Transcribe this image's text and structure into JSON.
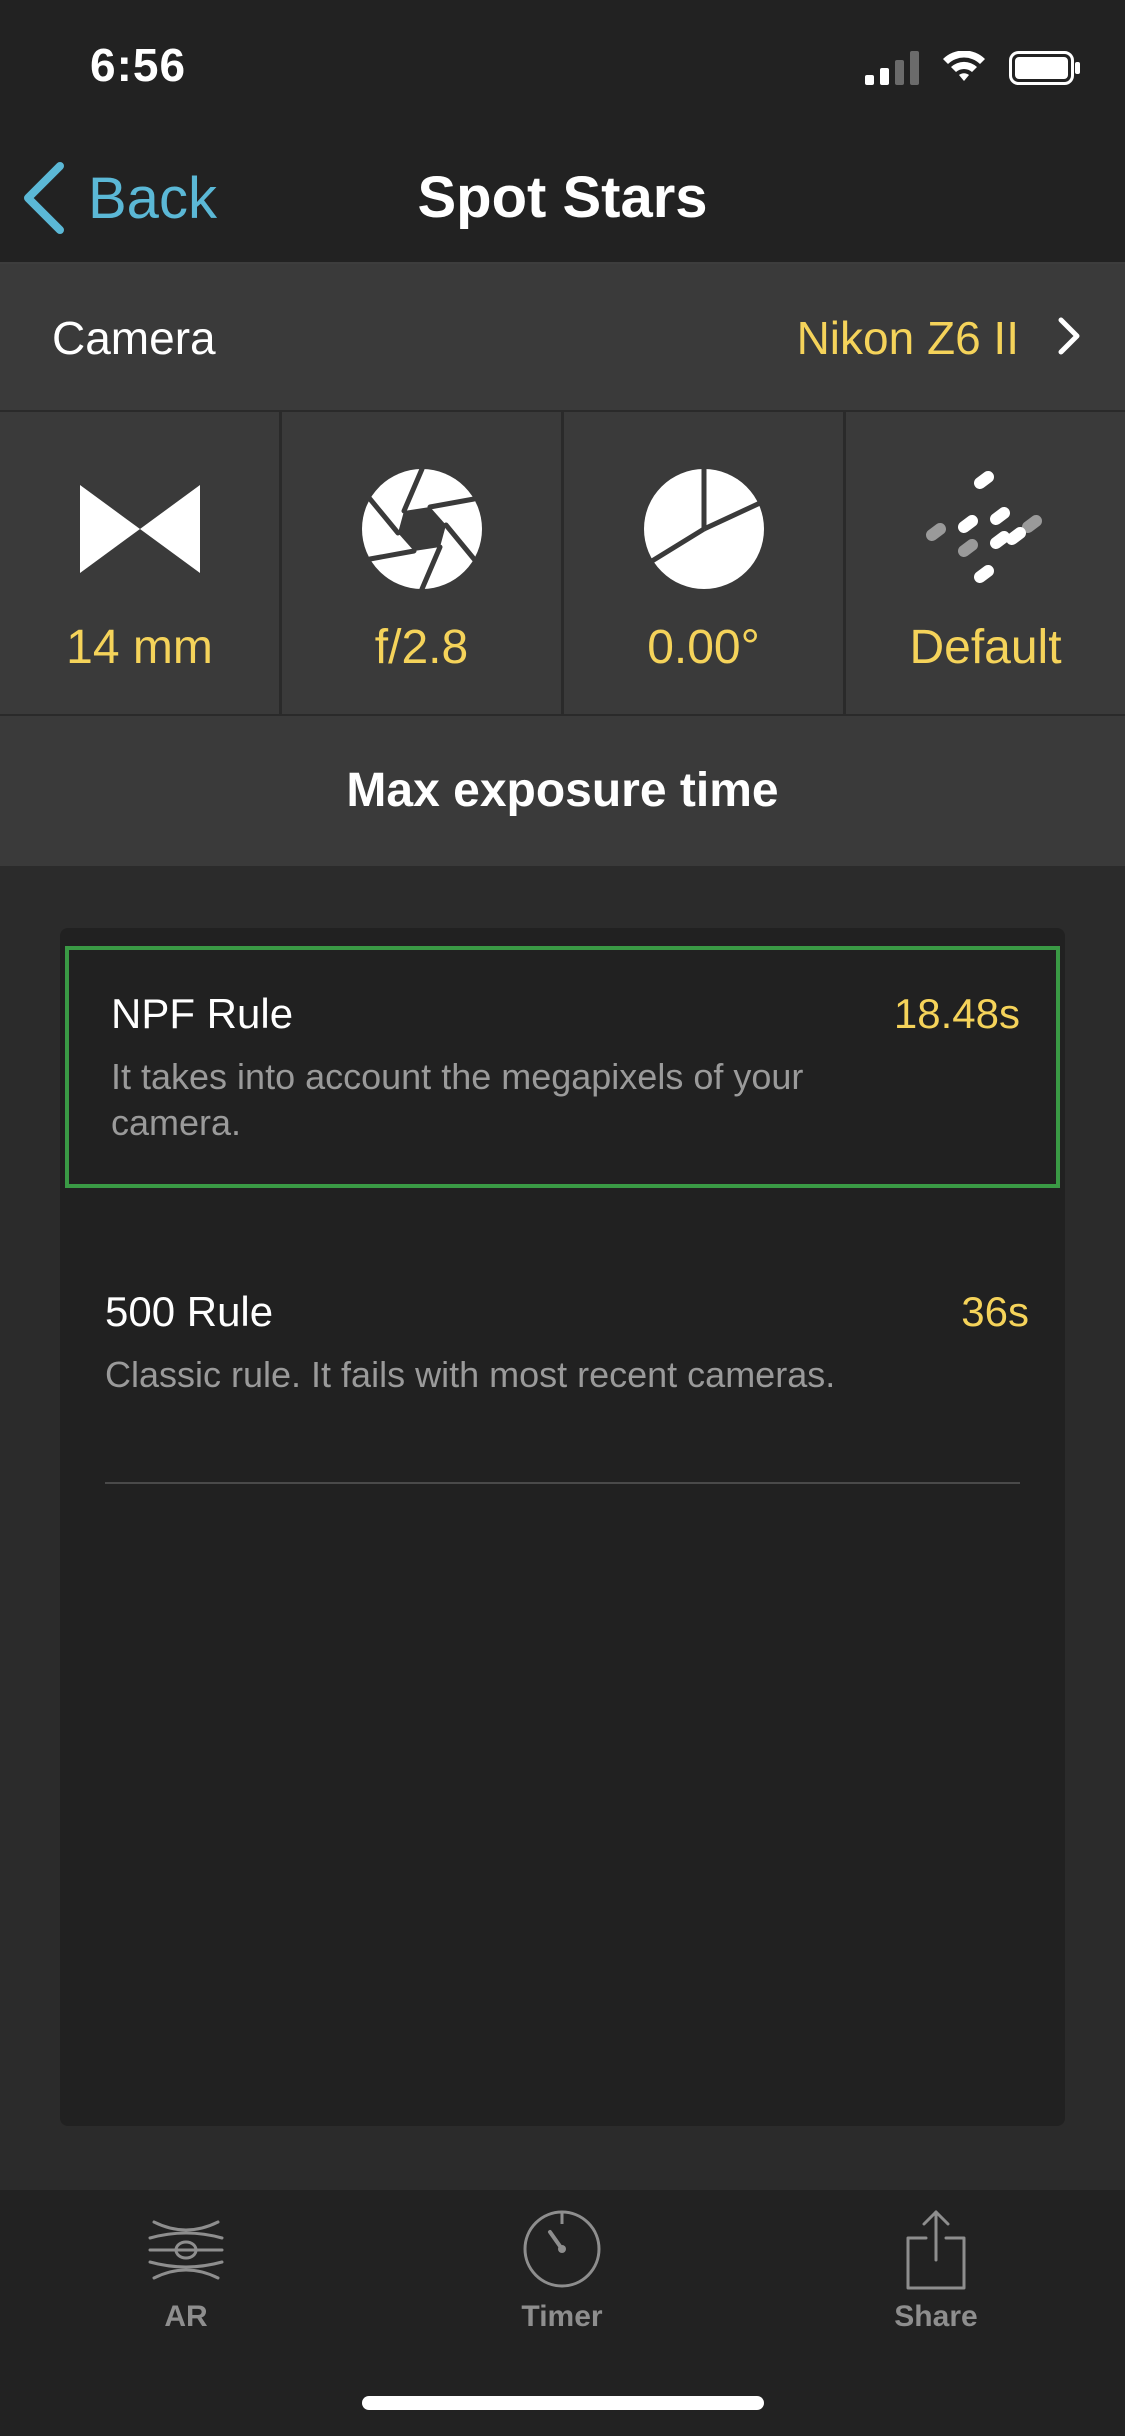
{
  "status_bar": {
    "time": "6:56"
  },
  "nav": {
    "back_label": "Back",
    "title": "Spot Stars"
  },
  "camera": {
    "label": "Camera",
    "value": "Nikon Z6 II"
  },
  "params": [
    {
      "icon": "focal-length-icon",
      "value": "14 mm"
    },
    {
      "icon": "aperture-icon",
      "value": "f/2.8"
    },
    {
      "icon": "declination-icon",
      "value": "0.00°"
    },
    {
      "icon": "accuracy-dots-icon",
      "value": "Default"
    }
  ],
  "section": {
    "title": "Max exposure time"
  },
  "rules": [
    {
      "name": "NPF Rule",
      "value": "18.48s",
      "description": "It takes into account the megapixels of your camera.",
      "selected": true
    },
    {
      "name": "500 Rule",
      "value": "36s",
      "description": "Classic rule. It fails with most recent cameras.",
      "selected": false
    }
  ],
  "tabs": [
    {
      "icon": "ar-icon",
      "label": "AR"
    },
    {
      "icon": "timer-icon",
      "label": "Timer"
    },
    {
      "icon": "share-icon",
      "label": "Share"
    }
  ],
  "colors": {
    "accent": "#f5d35a",
    "link": "#5bb8d6",
    "selection": "#3a9a45"
  }
}
